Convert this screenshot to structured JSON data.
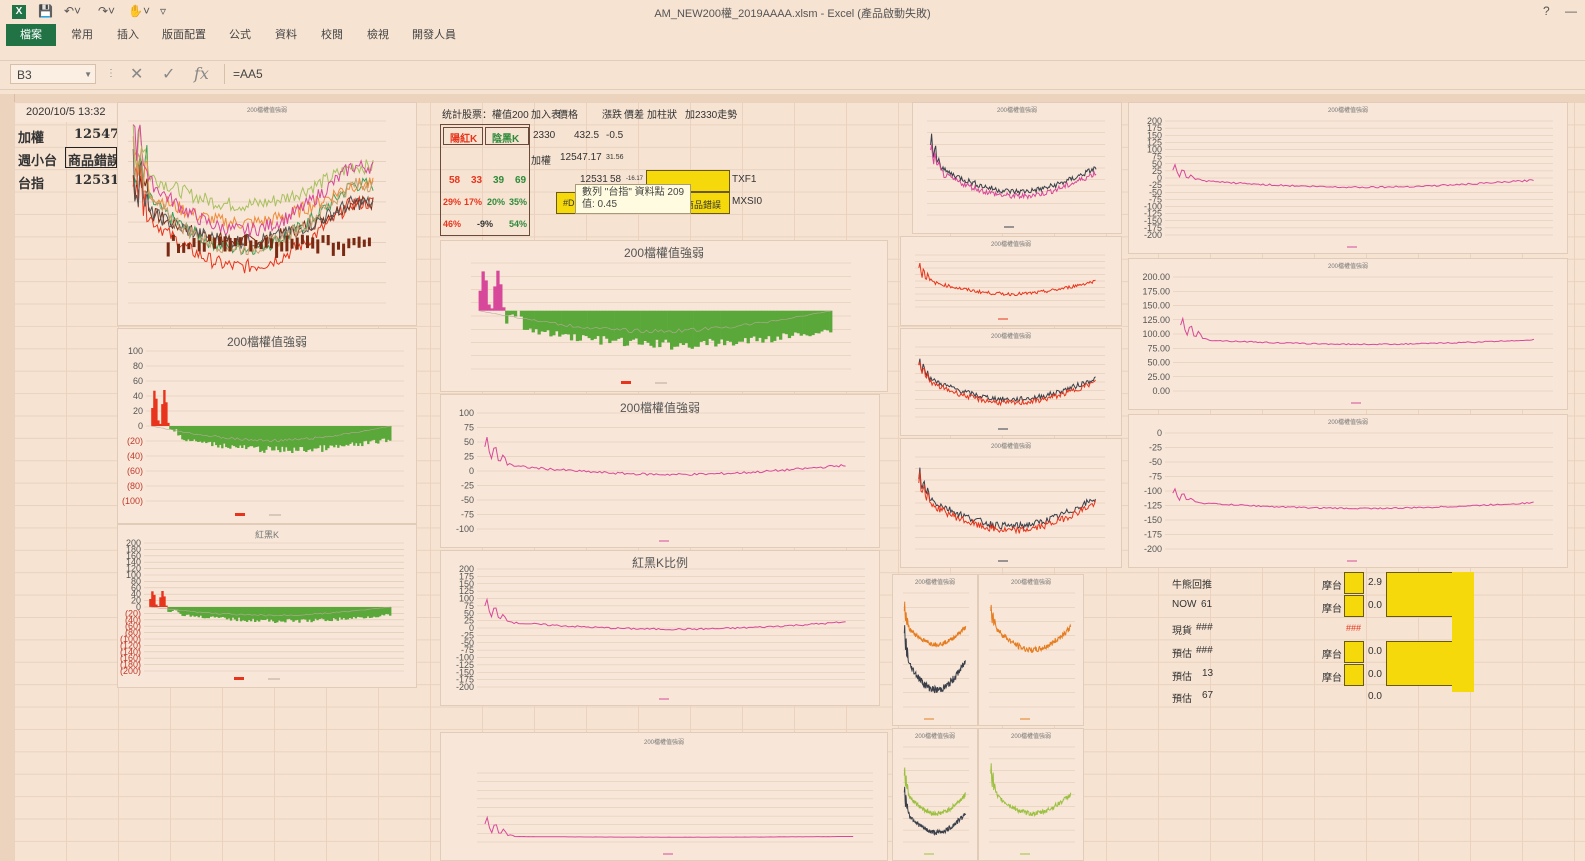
{
  "window": {
    "title": "AM_NEW200權_2019AAAA.xlsm - Excel (產品啟動失敗)",
    "help_icon": "?",
    "minimize_icon": "—",
    "app_icon": "X"
  },
  "ribbon": {
    "tabs": [
      "檔案",
      "常用",
      "插入",
      "版面配置",
      "公式",
      "資料",
      "校閱",
      "檢視",
      "開發人員"
    ]
  },
  "formula_bar": {
    "name_box": "B3",
    "formula": "=AA5"
  },
  "cells": {
    "datetime": "2020/10/5 13:32",
    "r1_label": "加權",
    "r1_value": "12547",
    "r2_label": "週小台",
    "r2_value": "商品錯誤",
    "r3_label": "台指",
    "r3_value": "12531"
  },
  "stats_table": {
    "header": "统計股票：權值200",
    "col_headers": [
      "加入表",
      "價格",
      "漲跌",
      "價差",
      "加柱狀",
      "加2330走勢"
    ],
    "red_k": "陽紅K",
    "black_k": "陰黑K",
    "row_2330": [
      "2330",
      "432.5",
      "-0.5"
    ],
    "row_index": [
      "加權",
      "12547.17",
      "31.56"
    ],
    "row_counts": [
      "58",
      "33",
      "39",
      "69"
    ],
    "row_counts_extra": [
      "12531",
      "58",
      "-16.17"
    ],
    "row_pct": [
      "29%",
      "17%",
      "20%",
      "35%"
    ],
    "row_net": [
      "46%",
      "-9%",
      "54%"
    ],
    "contract_1": "TXF1",
    "contract_2": "MXSI0",
    "error_cell": "商品錯誤",
    "hash_cell": "#D"
  },
  "tooltip": {
    "line1": "數列 \"台指\" 資料點 209",
    "line2": "值: 0.45"
  },
  "right_panel": {
    "labels": [
      "牛熊回推",
      "NOW",
      "現貨",
      "預估",
      "預估",
      "預估"
    ],
    "values": [
      "",
      "61",
      "###",
      "###",
      "13",
      "67"
    ],
    "mtx_label": "摩台",
    "mtx_values": [
      "2.9",
      "0.0",
      "###",
      "0.0",
      "0.0",
      "0.0"
    ]
  },
  "chart_titles": {
    "strength": "200檔權值強弱",
    "redblack": "紅黑K",
    "ratio": "紅黑K比例",
    "small": "200檔權值強弱"
  },
  "chart_data": [
    {
      "type": "area",
      "title": "200檔權值強弱",
      "ylim": [
        -100,
        100
      ],
      "yticks": [
        "100",
        "80",
        "60",
        "40",
        "20",
        "0",
        "(20)",
        "(40)",
        "(60)",
        "(80)",
        "(100)"
      ]
    },
    {
      "type": "area",
      "title": "紅黑K",
      "ylim": [
        -200,
        200
      ],
      "yticks": [
        "200",
        "180",
        "160",
        "140",
        "120",
        "100",
        "80",
        "60",
        "40",
        "20",
        "0",
        "(20)",
        "(40)",
        "(60)",
        "(80)",
        "(100)",
        "(120)",
        "(140)",
        "(160)",
        "(180)",
        "(200)"
      ]
    },
    {
      "type": "line",
      "title": "200檔權值強弱",
      "ylim": [
        -100,
        100
      ],
      "yticks": [
        "100",
        "75",
        "50",
        "25",
        "0",
        "-25",
        "-50",
        "-75",
        "-100"
      ]
    },
    {
      "type": "line",
      "title": "紅黑K比例",
      "ylim": [
        -200,
        200
      ],
      "yticks": [
        "200",
        "175",
        "150",
        "125",
        "100",
        "75",
        "50",
        "25",
        "0",
        "-25",
        "-50",
        "-75",
        "-100",
        "-125",
        "-150",
        "-175",
        "-200"
      ]
    },
    {
      "type": "line",
      "title": "200檔權值強弱",
      "ylim": [
        -200,
        200
      ],
      "yticks": [
        "200",
        "175",
        "150",
        "125",
        "100",
        "75",
        "50",
        "25",
        "0",
        "-25",
        "-50",
        "-75",
        "-100",
        "-125",
        "-150",
        "-175",
        "-200"
      ]
    },
    {
      "type": "line",
      "title": "200檔權值強弱",
      "ylim": [
        0,
        200
      ],
      "yticks": [
        "200.00",
        "175.00",
        "150.00",
        "125.00",
        "100.00",
        "75.00",
        "50.00",
        "25.00",
        "0.00"
      ]
    },
    {
      "type": "line",
      "title": "200檔權值強弱",
      "ylim": [
        -200,
        0
      ],
      "yticks": [
        "0",
        "-25",
        "-50",
        "-75",
        "-100",
        "-125",
        "-150",
        "-175",
        "-200"
      ]
    }
  ],
  "colors": {
    "accent": "#217346",
    "red": "#e8341c",
    "green": "#5aa83a",
    "pink": "#d8489a",
    "orange": "#e57c20",
    "dark": "#3a3f4a",
    "yellow": "#f5d90a"
  }
}
